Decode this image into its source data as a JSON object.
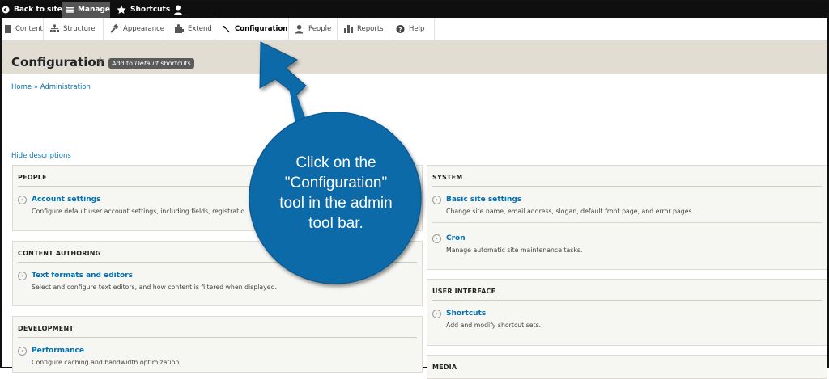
{
  "toolbar": {
    "back": "Back to site",
    "manage": "Manage",
    "shortcuts": "Shortcuts"
  },
  "menu": [
    {
      "label": "Content",
      "icon": "content-icon"
    },
    {
      "label": "Structure",
      "icon": "structure-icon"
    },
    {
      "label": "Appearance",
      "icon": "appearance-icon"
    },
    {
      "label": "Extend",
      "icon": "extend-icon"
    },
    {
      "label": "Configuration",
      "icon": "wrench-icon"
    },
    {
      "label": "People",
      "icon": "people-icon"
    },
    {
      "label": "Reports",
      "icon": "reports-icon"
    },
    {
      "label": "Help",
      "icon": "help-icon"
    }
  ],
  "page": {
    "title": "Configuration",
    "shortcut_badge_prefix": "Add to",
    "shortcut_badge_em": "Default",
    "shortcut_badge_suffix": "shortcuts",
    "breadcrumb": "Home » Administration",
    "hide_descriptions": "Hide descriptions"
  },
  "sections": {
    "people": {
      "title": "PEOPLE",
      "items": [
        {
          "link": "Account settings",
          "desc": "Configure default user account settings, including fields, registratio"
        }
      ]
    },
    "content_authoring": {
      "title": "CONTENT AUTHORING",
      "items": [
        {
          "link": "Text formats and editors",
          "desc": "Select and configure text editors, and how content is filtered when displayed."
        }
      ]
    },
    "development": {
      "title": "DEVELOPMENT",
      "items": [
        {
          "link": "Performance",
          "desc": "Configure caching and bandwidth optimization."
        }
      ]
    },
    "system": {
      "title": "SYSTEM",
      "items": [
        {
          "link": "Basic site settings",
          "desc": "Change site name, email address, slogan, default front page, and error pages."
        },
        {
          "link": "Cron",
          "desc": "Manage automatic site maintenance tasks."
        }
      ]
    },
    "user_interface": {
      "title": "USER INTERFACE",
      "items": [
        {
          "link": "Shortcuts",
          "desc": "Add and modify shortcut sets."
        }
      ]
    },
    "media": {
      "title": "MEDIA"
    }
  },
  "callout": {
    "line1": "Click on the",
    "line2": "\"Configuration\"",
    "line3": "tool in the admin",
    "line4": "tool bar.",
    "color": "#0f6ba9"
  }
}
